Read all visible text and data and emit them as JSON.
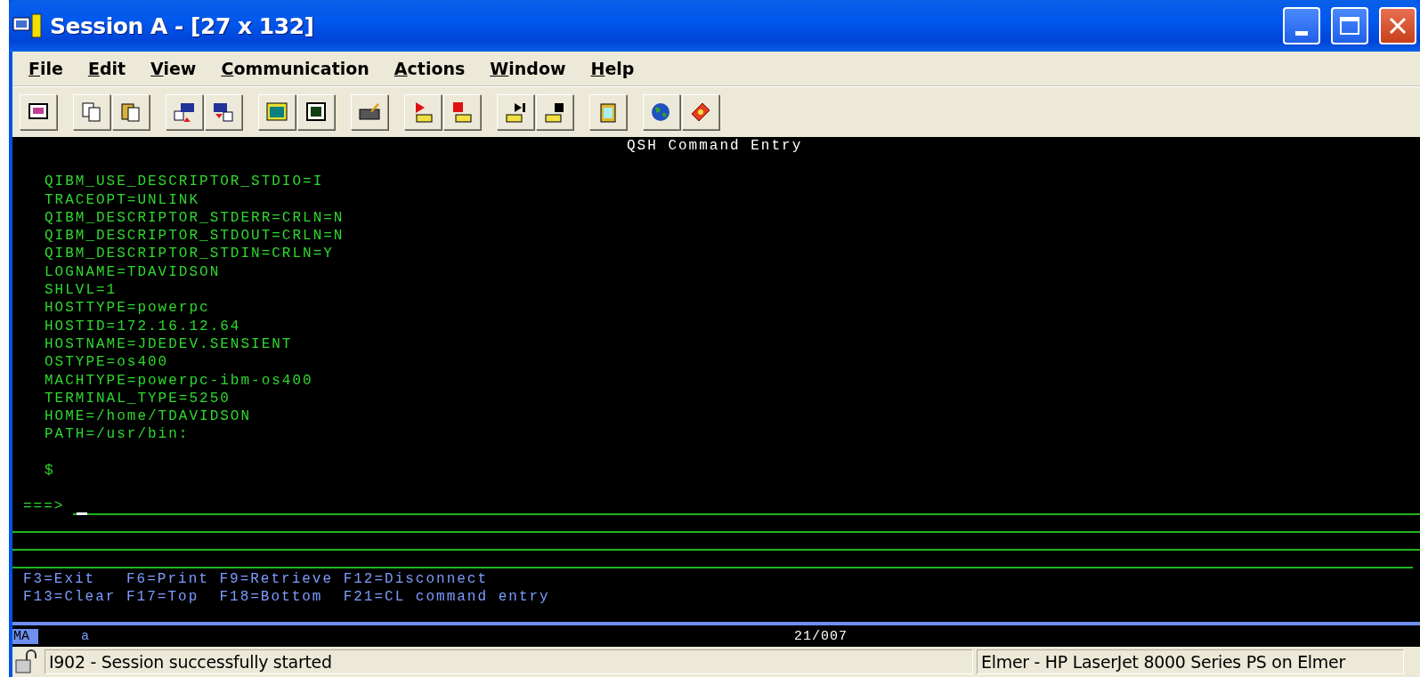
{
  "window": {
    "title": "Session A - [27 x 132]"
  },
  "menu": [
    {
      "label": "File"
    },
    {
      "label": "Edit"
    },
    {
      "label": "View"
    },
    {
      "label": "Communication"
    },
    {
      "label": "Actions"
    },
    {
      "label": "Window"
    },
    {
      "label": "Help"
    }
  ],
  "terminal": {
    "header": "QSH Command Entry",
    "lines": [
      "QIBM_USE_DESCRIPTOR_STDIO=I",
      "TRACEOPT=UNLINK",
      "QIBM_DESCRIPTOR_STDERR=CRLN=N",
      "QIBM_DESCRIPTOR_STDOUT=CRLN=N",
      "QIBM_DESCRIPTOR_STDIN=CRLN=Y",
      "LOGNAME=TDAVIDSON",
      "SHLVL=1",
      "HOSTTYPE=powerpc",
      "HOSTID=172.16.12.64",
      "HOSTNAME=JDEDEV.SENSIENT",
      "OSTYPE=os400",
      "MACHTYPE=powerpc-ibm-os400",
      "TERMINAL_TYPE=5250",
      "HOME=/home/TDAVIDSON",
      "PATH=/usr/bin:"
    ],
    "prompt": "$",
    "command_prompt": "===>",
    "function_keys": [
      "F3=Exit   F6=Print F9=Retrieve F12=Disconnect",
      "F13=Clear F17=Top  F18=Bottom  F21=CL command entry"
    ]
  },
  "oia": {
    "mode": "MA",
    "indicator": "a",
    "cursor_position": "21/007"
  },
  "status_bar": {
    "message": "I902 - Session successfully started",
    "printer": "Elmer - HP LaserJet 8000 Series PS on Elmer"
  }
}
